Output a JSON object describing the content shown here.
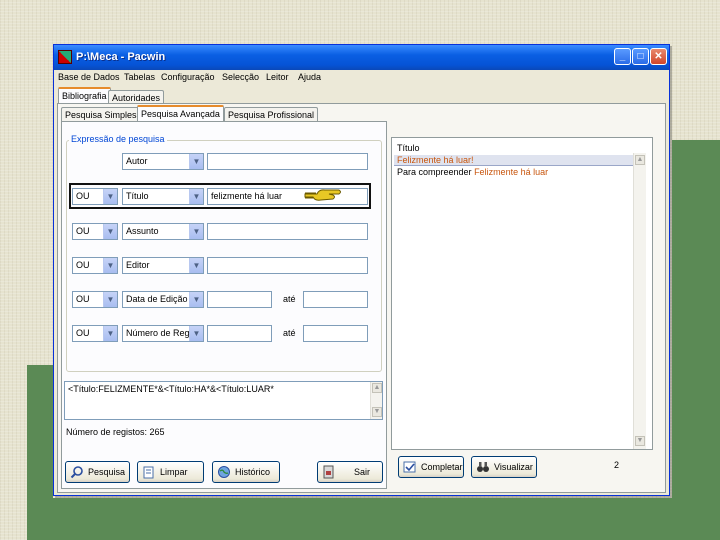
{
  "window": {
    "title": "P:\\Meca - Pacwin"
  },
  "menu": [
    "Base de Dados",
    "Tabelas",
    "Configuração",
    "Selecção",
    "Leitor",
    "Ajuda"
  ],
  "top_tabs": [
    {
      "label": "Bibliografia",
      "active": true
    },
    {
      "label": "Autoridades",
      "active": false
    }
  ],
  "search_tabs": [
    {
      "label": "Pesquisa Simples",
      "active": false
    },
    {
      "label": "Pesquisa Avançada",
      "active": true
    },
    {
      "label": "Pesquisa Profissional",
      "active": false
    }
  ],
  "expression_group": {
    "label": "Expressão de pesquisa",
    "rows": [
      {
        "operator": "",
        "field": "Autor",
        "value": "",
        "to_label": "",
        "value2": ""
      },
      {
        "operator": "OU",
        "field": "Título",
        "value": "felizmente há luar",
        "to_label": "",
        "value2": ""
      },
      {
        "operator": "OU",
        "field": "Assunto",
        "value": "",
        "to_label": "",
        "value2": ""
      },
      {
        "operator": "OU",
        "field": "Editor",
        "value": "",
        "to_label": "",
        "value2": ""
      },
      {
        "operator": "OU",
        "field": "Data de Edição",
        "value": "",
        "to_label": "até",
        "value2": ""
      },
      {
        "operator": "OU",
        "field": "Número de Regi",
        "value": "",
        "to_label": "até",
        "value2": ""
      }
    ]
  },
  "query_text": "<Título:FELIZMENTE*&<Título:HA*&<Título:LUAR*",
  "record_count": "Número de registos: 265",
  "buttons": {
    "search": "Pesquisa",
    "clear": "Limpar",
    "history": "Histórico",
    "exit": "Sair",
    "complete": "Completar",
    "view": "Visualizar"
  },
  "results": {
    "header": "Título",
    "rows": [
      {
        "prefix": "",
        "title": "Felizmente há luar!",
        "selected": true
      },
      {
        "prefix": "Para compreender",
        "title": "Felizmente há luar",
        "selected": false
      }
    ],
    "count": "2"
  },
  "colors": {
    "result_title": "#c8560e",
    "selected_row": "#dfe3ef",
    "highlight_border": "#111111",
    "pointer_hand": "#e8c825"
  },
  "icons": {
    "search": "magnifier-icon",
    "clear": "clear-icon",
    "history": "globe-icon",
    "exit": "exit-door-icon",
    "complete": "complete-icon",
    "view": "binoculars-icon",
    "pointer": "pointing-hand-icon"
  }
}
